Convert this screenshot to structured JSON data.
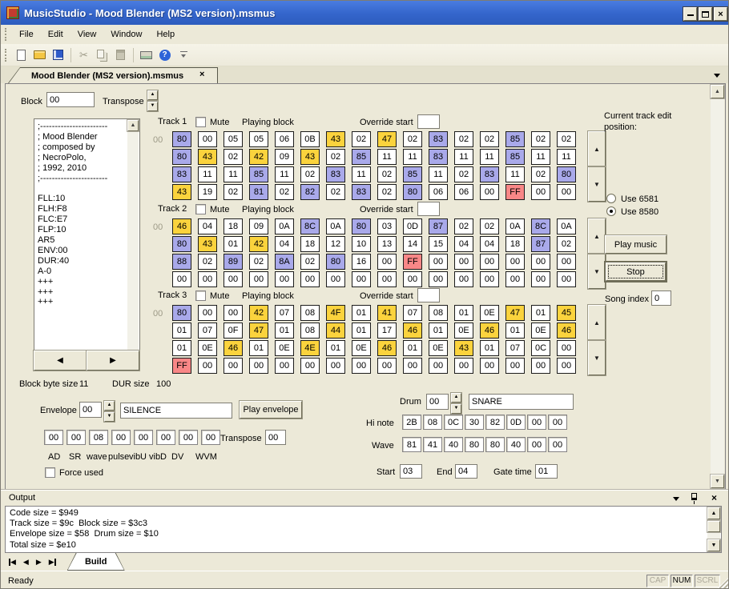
{
  "window": {
    "title": "MusicStudio - Mood Blender (MS2 version).msmus",
    "minimize": "minimize",
    "maximize": "maximize",
    "close": "close"
  },
  "menu": {
    "items": [
      "File",
      "Edit",
      "View",
      "Window",
      "Help"
    ]
  },
  "toolbar": {
    "icons": [
      "new-document",
      "open-folder",
      "save",
      "cut",
      "copy",
      "paste",
      "print",
      "help"
    ],
    "help_glyph": "?"
  },
  "doc_tab": {
    "label": "Mood Blender (MS2 version).msmus",
    "close_glyph": "×"
  },
  "controls": {
    "block_label": "Block",
    "block_value": "00",
    "transpose_label": "Transpose",
    "spin_up": "▲",
    "spin_down": "▼"
  },
  "memo": {
    "lines": [
      ";-----------------------",
      "; Mood Blender",
      "; composed by",
      "; NecroPolo,",
      "; 1992, 2010",
      ";-----------------------",
      "",
      "FLL:10",
      "FLH:F8",
      "FLC:E7",
      "FLP:10",
      "AR5",
      "ENV:00",
      "DUR:40",
      "A-0",
      "+++",
      "+++",
      "+++"
    ]
  },
  "nav": {
    "prev": "◀",
    "next": "▶"
  },
  "info": {
    "block_byte_size_label": "Block byte size",
    "block_byte_size": "11",
    "dur_size_label": "DUR size",
    "dur_size": "100"
  },
  "tracks": [
    {
      "label": "Track 1",
      "mute_label": "Mute",
      "playing_label": "Playing block",
      "override_label": "Override start",
      "override_value": "",
      "row_index": "00",
      "rows": [
        [
          "80b",
          "00w",
          "05w",
          "05w",
          "06w",
          "0Bw",
          "43y",
          "02w",
          "47y",
          "02w",
          "83b",
          "02w",
          "02w",
          "85b",
          "02w",
          "02w"
        ],
        [
          "80b",
          "43y",
          "02w",
          "42y",
          "09w",
          "43y",
          "02w",
          "85b",
          "11w",
          "11w",
          "83b",
          "11w",
          "11w",
          "85b",
          "11w",
          "11w"
        ],
        [
          "83b",
          "11w",
          "11w",
          "85b",
          "11w",
          "02w",
          "83b",
          "11w",
          "02w",
          "85b",
          "11w",
          "02w",
          "83b",
          "11w",
          "02w",
          "80b"
        ],
        [
          "43y",
          "19w",
          "02w",
          "81b",
          "02w",
          "82b",
          "02w",
          "83b",
          "02w",
          "80b",
          "06w",
          "06w",
          "00w",
          "FFr",
          "00w",
          "00w"
        ]
      ]
    },
    {
      "label": "Track 2",
      "mute_label": "Mute",
      "playing_label": "Playing block",
      "override_label": "Override start",
      "override_value": "",
      "row_index": "00",
      "rows": [
        [
          "46y",
          "04w",
          "18w",
          "09w",
          "0Aw",
          "8Cb",
          "0Aw",
          "80b",
          "03w",
          "0Dw",
          "87b",
          "02w",
          "02w",
          "0Aw",
          "8Cb",
          "0Aw"
        ],
        [
          "80b",
          "43y",
          "01w",
          "42y",
          "04w",
          "18w",
          "12w",
          "10w",
          "13w",
          "14w",
          "15w",
          "04w",
          "04w",
          "18w",
          "87b",
          "02w"
        ],
        [
          "88b",
          "02w",
          "89b",
          "02w",
          "8Ab",
          "02w",
          "80b",
          "16w",
          "00w",
          "FFr",
          "00w",
          "00w",
          "00w",
          "00w",
          "00w",
          "00w"
        ],
        [
          "00w",
          "00w",
          "00w",
          "00w",
          "00w",
          "00w",
          "00w",
          "00w",
          "00w",
          "00w",
          "00w",
          "00w",
          "00w",
          "00w",
          "00w",
          "00w"
        ]
      ]
    },
    {
      "label": "Track 3",
      "mute_label": "Mute",
      "playing_label": "Playing block",
      "override_label": "Override start",
      "override_value": "",
      "row_index": "00",
      "rows": [
        [
          "80b",
          "00w",
          "00w",
          "42y",
          "07w",
          "08w",
          "4Fy",
          "01w",
          "41y",
          "07w",
          "08w",
          "01w",
          "0Ew",
          "47y",
          "01w",
          "45y"
        ],
        [
          "01w",
          "07w",
          "0Fw",
          "47y",
          "01w",
          "08w",
          "44y",
          "01w",
          "17w",
          "46y",
          "01w",
          "0Ew",
          "46y",
          "01w",
          "0Ew",
          "46y"
        ],
        [
          "01w",
          "0Ew",
          "46y",
          "01w",
          "0Ew",
          "4Ey",
          "01w",
          "0Ew",
          "46y",
          "01w",
          "0Ew",
          "43y",
          "01w",
          "07w",
          "0Cw",
          "00w"
        ],
        [
          "FFr",
          "00w",
          "00w",
          "00w",
          "00w",
          "00w",
          "00w",
          "00w",
          "00w",
          "00w",
          "00w",
          "00w",
          "00w",
          "00w",
          "00w",
          "00w"
        ]
      ]
    }
  ],
  "right_panel": {
    "edit_pos_label": "Current track edit position:",
    "radio_6581": "Use 6581",
    "radio_8580": "Use 8580",
    "selected_radio": "Use 8580",
    "play_music_button": "Play music",
    "stop_button": "Stop",
    "song_index_label": "Song index",
    "song_index_value": "0"
  },
  "envelope": {
    "label": "Envelope",
    "index": "00",
    "name": "SILENCE",
    "play_button": "Play envelope",
    "values": [
      "00",
      "00",
      "08",
      "00",
      "00",
      "00",
      "00",
      "00"
    ],
    "field_labels": [
      "AD",
      "SR",
      "wave",
      "pulse",
      "vibU",
      "vibD",
      "DV",
      "WVM"
    ],
    "transpose_label": "Transpose",
    "transpose_value": "00",
    "force_used_label": "Force used"
  },
  "drum": {
    "label": "Drum",
    "index": "00",
    "name": "SNARE",
    "hi_note_label": "Hi note",
    "hi_note": [
      "2B",
      "08",
      "0C",
      "30",
      "82",
      "0D",
      "00",
      "00"
    ],
    "wave_label": "Wave",
    "wave": [
      "81",
      "41",
      "40",
      "80",
      "80",
      "40",
      "00",
      "00"
    ],
    "start_label": "Start",
    "start": "03",
    "end_label": "End",
    "end": "04",
    "gate_label": "Gate time",
    "gate": "01"
  },
  "output": {
    "title": "Output",
    "lines": [
      "Code size = $949",
      "Track size = $9c  Block size = $3c3",
      "Envelope size = $58  Drum size = $10",
      "Total size = $e10"
    ],
    "tab_label": "Build"
  },
  "statusbar": {
    "ready": "Ready",
    "indicators": [
      "CAP",
      "NUM",
      "SCRL"
    ],
    "active_indicator": "NUM"
  },
  "colors": {
    "titlebar_blue": "#3465CB",
    "cell_blue": "#A9A9EA",
    "cell_yellow": "#FBD33D",
    "cell_red": "#F98787",
    "background": "#ECE9D8"
  }
}
